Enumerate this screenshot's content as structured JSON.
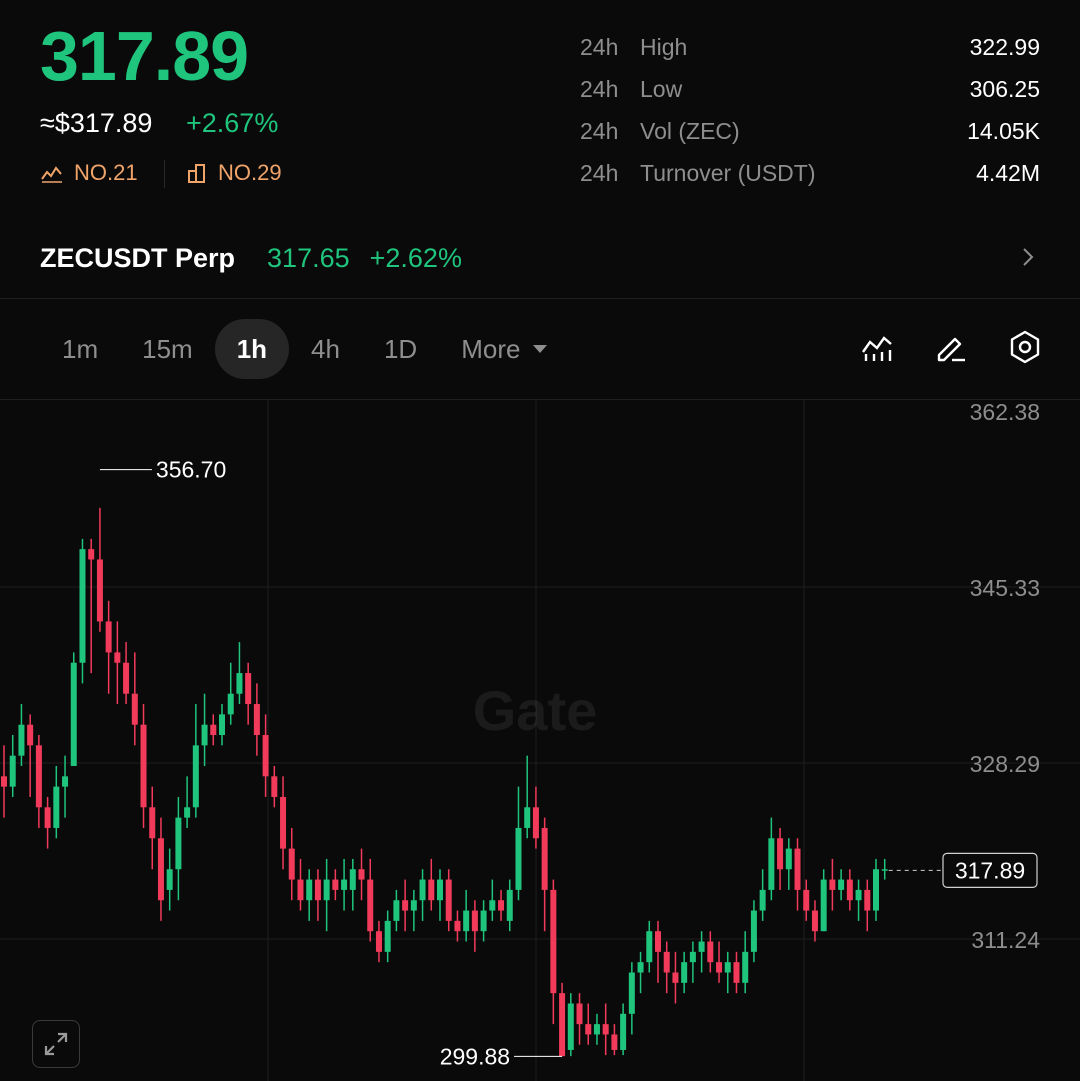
{
  "header": {
    "last_price": "317.89",
    "usd_price": "≈$317.89",
    "change_pct": "+2.67%",
    "rank_1": "NO.21",
    "rank_2": "NO.29",
    "rank_1_icon": "trend-rank-icon",
    "rank_2_icon": "market-cap-rank-icon"
  },
  "stats": [
    {
      "period": "24h",
      "label": "High",
      "value": "322.99"
    },
    {
      "period": "24h",
      "label": "Low",
      "value": "306.25"
    },
    {
      "period": "24h",
      "label": "Vol (ZEC)",
      "value": "14.05K"
    },
    {
      "period": "24h",
      "label": "Turnover (USDT)",
      "value": "4.42M"
    }
  ],
  "perp": {
    "symbol": "ZECUSDT Perp",
    "price": "317.65",
    "change": "+2.62%"
  },
  "timeframes": {
    "items": [
      "1m",
      "15m",
      "1h",
      "4h",
      "1D"
    ],
    "active": "1h",
    "more_label": "More"
  },
  "colors": {
    "up": "#1fc47d",
    "down": "#f23b5a",
    "rank": "#f0a46a"
  },
  "chart_data": {
    "type": "candlestick",
    "y_ticks": [
      "362.38",
      "345.33",
      "328.29",
      "311.24"
    ],
    "ylim": [
      297.5,
      362.38
    ],
    "high_marker": "356.70",
    "low_marker": "299.88",
    "last_price_label": "317.89",
    "watermark": "Gate",
    "candles": [
      [
        327,
        326,
        330,
        323
      ],
      [
        326,
        329,
        331,
        325
      ],
      [
        329,
        332,
        334,
        328
      ],
      [
        332,
        330,
        333,
        325
      ],
      [
        330,
        324,
        331,
        322
      ],
      [
        324,
        322,
        325,
        320
      ],
      [
        322,
        326,
        328,
        321
      ],
      [
        326,
        327,
        329,
        323
      ],
      [
        328,
        338,
        339,
        337
      ],
      [
        338,
        349,
        350,
        336
      ],
      [
        349,
        348,
        350,
        337
      ],
      [
        348,
        342,
        353,
        341
      ],
      [
        342,
        339,
        344,
        335
      ],
      [
        339,
        338,
        342,
        334
      ],
      [
        338,
        335,
        340,
        334
      ],
      [
        335,
        332,
        339,
        330
      ],
      [
        332,
        324,
        334,
        322
      ],
      [
        324,
        321,
        326,
        318
      ],
      [
        321,
        315,
        323,
        313
      ],
      [
        316,
        318,
        320,
        314
      ],
      [
        318,
        323,
        325,
        315
      ],
      [
        323,
        324,
        327,
        322
      ],
      [
        324,
        330,
        334,
        323
      ],
      [
        330,
        332,
        335,
        328
      ],
      [
        332,
        331,
        333,
        330
      ],
      [
        331,
        333,
        334,
        330
      ],
      [
        333,
        335,
        338,
        332
      ],
      [
        335,
        337,
        340,
        334
      ],
      [
        337,
        334,
        338,
        332
      ],
      [
        334,
        331,
        336,
        329
      ],
      [
        331,
        327,
        333,
        325
      ],
      [
        327,
        325,
        328,
        324
      ],
      [
        325,
        320,
        327,
        318
      ],
      [
        320,
        317,
        322,
        315
      ],
      [
        317,
        315,
        319,
        314
      ],
      [
        315,
        317,
        318,
        313
      ],
      [
        317,
        315,
        318,
        313
      ],
      [
        315,
        317,
        319,
        312
      ],
      [
        317,
        316,
        318,
        315
      ],
      [
        316,
        317,
        319,
        314
      ],
      [
        316,
        318,
        319,
        314
      ],
      [
        318,
        317,
        320,
        315
      ],
      [
        317,
        312,
        319,
        311
      ],
      [
        312,
        310,
        313,
        309
      ],
      [
        310,
        313,
        314,
        309
      ],
      [
        313,
        315,
        316,
        312
      ],
      [
        315,
        314,
        317,
        312
      ],
      [
        314,
        315,
        316,
        312
      ],
      [
        315,
        317,
        318,
        313
      ],
      [
        317,
        315,
        319,
        314
      ],
      [
        315,
        317,
        318,
        313
      ],
      [
        317,
        313,
        318,
        312
      ],
      [
        313,
        312,
        314,
        311
      ],
      [
        312,
        314,
        316,
        311
      ],
      [
        314,
        312,
        315,
        310
      ],
      [
        312,
        314,
        315,
        311
      ],
      [
        314,
        315,
        317,
        313
      ],
      [
        315,
        314,
        316,
        313
      ],
      [
        313,
        316,
        317,
        312
      ],
      [
        316,
        322,
        326,
        315
      ],
      [
        322,
        324,
        329,
        321
      ],
      [
        324,
        321,
        326,
        320
      ],
      [
        322,
        316,
        323,
        312
      ],
      [
        316,
        306,
        317,
        303
      ],
      [
        306,
        299.9,
        307,
        299.9
      ],
      [
        300.5,
        305,
        306,
        299.9
      ],
      [
        305,
        303,
        306,
        301
      ],
      [
        303,
        302,
        305,
        301
      ],
      [
        302,
        303,
        304,
        301
      ],
      [
        303,
        302,
        305,
        300
      ],
      [
        302,
        300.5,
        303,
        300
      ],
      [
        300.5,
        304,
        305,
        300
      ],
      [
        304,
        308,
        309,
        302
      ],
      [
        308,
        309,
        310,
        306
      ],
      [
        309,
        312,
        313,
        308
      ],
      [
        312,
        310,
        313,
        307
      ],
      [
        310,
        308,
        311,
        306
      ],
      [
        308,
        307,
        310,
        305
      ],
      [
        307,
        309,
        310,
        306
      ],
      [
        309,
        310,
        311,
        307
      ],
      [
        310,
        311,
        312,
        308
      ],
      [
        311,
        309,
        312,
        308
      ],
      [
        309,
        308,
        311,
        307
      ],
      [
        308,
        309,
        310,
        306
      ],
      [
        309,
        307,
        310,
        306
      ],
      [
        307,
        310,
        312,
        306
      ],
      [
        310,
        314,
        315,
        309
      ],
      [
        314,
        316,
        318,
        313
      ],
      [
        316,
        321,
        323,
        315
      ],
      [
        321,
        318,
        322,
        316
      ],
      [
        318,
        320,
        321,
        316
      ],
      [
        320,
        316,
        321,
        314
      ],
      [
        316,
        314,
        317,
        313
      ],
      [
        314,
        312,
        315,
        311
      ],
      [
        312,
        317,
        318,
        312
      ],
      [
        317,
        316,
        319,
        314
      ],
      [
        316,
        317,
        318,
        315
      ],
      [
        317,
        315,
        318,
        314
      ],
      [
        315,
        316,
        317,
        313
      ],
      [
        316,
        314,
        317,
        312
      ],
      [
        314,
        318,
        319,
        313
      ],
      [
        318,
        318,
        319,
        317
      ]
    ]
  }
}
